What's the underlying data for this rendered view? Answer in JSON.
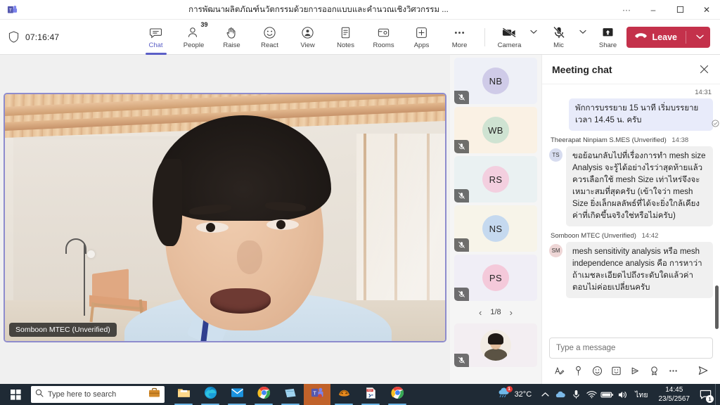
{
  "titlebar": {
    "app_icon": "teams-icon",
    "title": "การพัฒนาผลิตภัณฑ์นวัตกรรมด้วยการออกแบบและคำนวณเชิงวิศวกรรม ...",
    "more_label": "···",
    "minimize_label": "–",
    "restore_label": "❐",
    "close_label": "✕"
  },
  "toolbar": {
    "shield_icon": "shield-icon",
    "timer": "07:16:47",
    "buttons": [
      {
        "name": "chat",
        "label": "Chat",
        "icon": "chat-bubble-icon",
        "active": true
      },
      {
        "name": "people",
        "label": "People",
        "icon": "person-icon",
        "badge": "39",
        "active": false
      },
      {
        "name": "raise",
        "label": "Raise",
        "icon": "raised-hand-icon",
        "active": false
      },
      {
        "name": "react",
        "label": "React",
        "icon": "smiley-icon",
        "active": false
      },
      {
        "name": "view",
        "label": "View",
        "icon": "view-icon",
        "active": false
      },
      {
        "name": "notes",
        "label": "Notes",
        "icon": "notes-icon",
        "active": false
      },
      {
        "name": "rooms",
        "label": "Rooms",
        "icon": "breakout-rooms-icon",
        "active": false
      },
      {
        "name": "apps",
        "label": "Apps",
        "icon": "plus-square-icon",
        "active": false
      },
      {
        "name": "more",
        "label": "More",
        "icon": "ellipsis-icon",
        "active": false
      }
    ],
    "camera": {
      "label": "Camera",
      "icon": "camera-off-icon",
      "state": "off"
    },
    "mic": {
      "label": "Mic",
      "icon": "mic-muted-icon",
      "state": "muted"
    },
    "share": {
      "label": "Share",
      "icon": "share-screen-icon"
    },
    "leave": {
      "label": "Leave",
      "icon": "hangup-icon",
      "color": "#c4314b"
    }
  },
  "stage": {
    "active_speaker": {
      "name_label": "Somboon MTEC (Unverified)",
      "border_color": "#8e8ccd"
    }
  },
  "rail": {
    "participants": [
      {
        "initials": "NB",
        "avatar_color": "#cfcbe8",
        "tile_bg": "#eef0f7",
        "muted": true
      },
      {
        "initials": "WB",
        "avatar_color": "#cfe3d2",
        "tile_bg": "#faf1e4",
        "muted": true
      },
      {
        "initials": "RS",
        "avatar_color": "#f3cfdf",
        "tile_bg": "#eaf1f2",
        "muted": true
      },
      {
        "initials": "NS",
        "avatar_color": "#c5d9ef",
        "tile_bg": "#f7f4e9",
        "muted": true
      },
      {
        "initials": "PS",
        "avatar_color": "#f4c9da",
        "tile_bg": "#f0eef6",
        "muted": true
      }
    ],
    "pager": {
      "prev": "‹",
      "text": "1/8",
      "next": "›"
    },
    "self_tile": {
      "avatar": "photo-avatar",
      "tile_bg": "#f3eef2",
      "muted": true
    }
  },
  "chat": {
    "title": "Meeting chat",
    "close_icon": "close-icon",
    "messages": [
      {
        "direction": "outgoing",
        "time": "14:31",
        "text": "พักการบรรยาย 15 นาที เริ่มบรรยายเวลา 14.45 น. ครับ",
        "read_icon": "seen-check-icon"
      },
      {
        "direction": "incoming",
        "author": "Theerapat Ninpiam S.MES (Unverified)",
        "time": "14:38",
        "initials": "TS",
        "avatar_color": "#d7dcef",
        "text": "ขอย้อนกลับไปที่เรื่องการทำ mesh size Analysis จะรู้ได้อย่างไรว่าสุดท้ายแล้วควรเลือกใช้ mesh Size เท่าไหร่จึงจะเหมาะสมที่สุดครับ (เข้าใจว่า mesh Size ยิ่งเล็กผลลัพธ์ที่ได้จะยิ่งใกล้เคียงค่าที่เกิดขึ้นจริงใช่หรือไม่ครับ)"
      },
      {
        "direction": "incoming",
        "author": "Somboon MTEC (Unverified)",
        "time": "14:42",
        "initials": "SM",
        "avatar_color": "#eed6d6",
        "text": "mesh sensitivity analysis หรือ mesh independence analysis คือ การหาว่าถ้าเมชละเอียดไปถึงระดับใดแล้วค่าตอบไม่ค่อยเปลี่ยนครับ"
      }
    ],
    "compose": {
      "placeholder": "Type a message",
      "icons": [
        {
          "name": "format-text-icon",
          "glyph": "format"
        },
        {
          "name": "delivery-options-icon",
          "glyph": "important"
        },
        {
          "name": "emoji-icon",
          "glyph": "emoji"
        },
        {
          "name": "sticker-icon",
          "glyph": "sticker"
        },
        {
          "name": "loop-component-icon",
          "glyph": "loop"
        },
        {
          "name": "praise-icon",
          "glyph": "praise"
        },
        {
          "name": "more-options-icon",
          "glyph": "more"
        }
      ],
      "send_icon": "send-icon"
    }
  },
  "taskbar": {
    "start_label": "start-icon",
    "search_placeholder": "Type here to search",
    "search_icon": "search-icon",
    "briefcase_icon": "briefcase-icon",
    "apps": [
      {
        "name": "file-explorer",
        "icon": "folder-icon",
        "running": true,
        "active": false
      },
      {
        "name": "microsoft-edge",
        "icon": "edge-icon",
        "running": true,
        "active": false
      },
      {
        "name": "mail",
        "icon": "mail-icon",
        "running": true,
        "active": false
      },
      {
        "name": "google-chrome",
        "icon": "chrome-icon",
        "running": true,
        "active": false
      },
      {
        "name": "sticky-notes",
        "icon": "note-icon",
        "running": true,
        "active": false
      },
      {
        "name": "microsoft-teams",
        "icon": "teams-icon",
        "running": true,
        "active": true
      },
      {
        "name": "ansys",
        "icon": "ansys-icon",
        "running": true,
        "active": false
      },
      {
        "name": "pdf-document",
        "icon": "pdf-icon",
        "running": true,
        "active": false
      },
      {
        "name": "google-chrome-2",
        "icon": "chrome-icon",
        "running": true,
        "active": false
      }
    ],
    "weather": {
      "icon": "rain-cloud-icon",
      "temperature": "32°C",
      "badge": "1"
    },
    "tray": [
      {
        "name": "show-hidden-icons",
        "icon": "chevron-up-icon"
      },
      {
        "name": "onedrive",
        "icon": "cloud-icon"
      },
      {
        "name": "microphone",
        "icon": "mic-icon"
      },
      {
        "name": "network",
        "icon": "wifi-icon"
      },
      {
        "name": "battery",
        "icon": "battery-icon"
      },
      {
        "name": "volume",
        "icon": "speaker-icon"
      }
    ],
    "language": "ไทย",
    "clock_time": "14:45",
    "clock_date": "23/5/2567",
    "notification_icon": "notification-icon",
    "notification_badge": "1"
  }
}
